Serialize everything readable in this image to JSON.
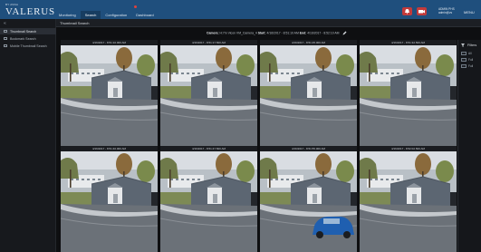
{
  "app": {
    "brand_small": "BY ASSA",
    "brand": "VALERUS"
  },
  "nav": [
    {
      "label": "Monitoring",
      "active": false
    },
    {
      "label": "Search",
      "active": true
    },
    {
      "label": "Configuration",
      "active": false
    },
    {
      "label": "Dashboard",
      "active": false
    }
  ],
  "user": {
    "line1": "ADMIN PHS",
    "line2": "admin@vs",
    "menu": "MENU"
  },
  "sidebar": {
    "collapse": "«",
    "items": [
      {
        "label": "Thumbnail Search",
        "active": true
      },
      {
        "label": "Bookmark Search",
        "active": false
      },
      {
        "label": "Mobile Thumbnail Search",
        "active": false
      }
    ]
  },
  "page": {
    "title": "Thumbnail Search"
  },
  "info": {
    "camera_label": "Camera:",
    "camera_value": "H:7m Vicon VM_Camera_4",
    "start_label": "Start:",
    "start_value": "4/16/2017 - 8:51:10 AM",
    "end_label": "End:",
    "end_value": "4/16/2017 - 8:52:10 AM"
  },
  "thumbnails": [
    {
      "timestamp": "4/16/2017 - 8:51:10.000 AM",
      "car": false
    },
    {
      "timestamp": "4/16/2017 - 8:51:17.500 AM",
      "car": false
    },
    {
      "timestamp": "4/16/2017 - 8:51:25.000 AM",
      "car": false
    },
    {
      "timestamp": "4/16/2017 - 8:51:32.500 AM",
      "car": false
    },
    {
      "timestamp": "4/16/2017 - 8:51:40.000 AM",
      "car": false
    },
    {
      "timestamp": "4/16/2017 - 8:51:47.500 AM",
      "car": false
    },
    {
      "timestamp": "4/16/2017 - 8:51:55.000 AM",
      "car": true
    },
    {
      "timestamp": "4/16/2017 - 8:52:02.500 AM",
      "car": false
    }
  ],
  "filter": {
    "title": "Filters",
    "items": [
      {
        "label": "All"
      },
      {
        "label": "Full"
      },
      {
        "label": "Full"
      }
    ]
  },
  "colors": {
    "topbar": "#1f4f7d",
    "alarm": "#e0413b",
    "car": "#1f5fb0"
  },
  "icons": [
    "menu-icon",
    "bell-icon",
    "video-icon",
    "pencil-icon",
    "filter-icon"
  ]
}
